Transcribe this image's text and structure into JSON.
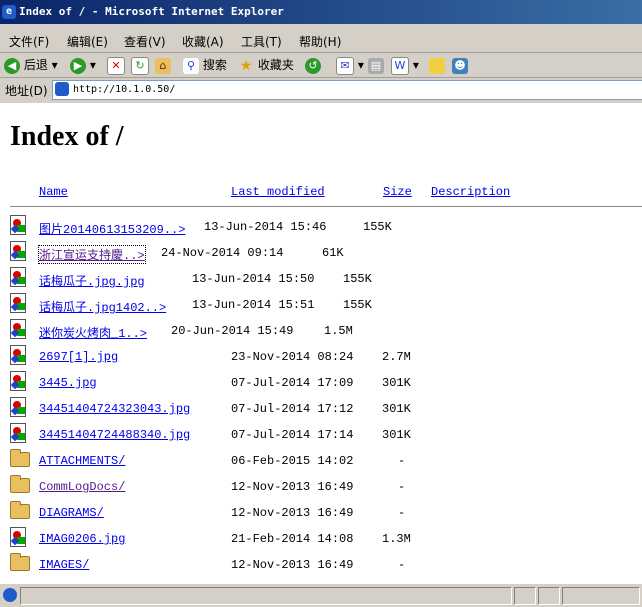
{
  "window": {
    "title": "Index of / - Microsoft Internet Explorer"
  },
  "menu": [
    {
      "label": "文件(F)"
    },
    {
      "label": "编辑(E)"
    },
    {
      "label": "查看(V)"
    },
    {
      "label": "收藏(A)"
    },
    {
      "label": "工具(T)"
    },
    {
      "label": "帮助(H)"
    }
  ],
  "toolbar": {
    "back_label": "后退",
    "search_label": "搜索",
    "favorites_label": "收藏夹"
  },
  "address": {
    "label": "地址(D)",
    "url": "http://10.1.0.50/"
  },
  "page": {
    "heading": "Index of /",
    "columns": {
      "name": "Name",
      "modified": "Last modified",
      "size": "Size",
      "description": "Description"
    }
  },
  "files": [
    {
      "type": "file",
      "name": "图片20140613153209..>",
      "date": "13-Jun-2014 15:46",
      "size": "155K"
    },
    {
      "type": "file",
      "name": "浙江宣运支持慶..>",
      "date": "24-Nov-2014 09:14",
      "size": "61K"
    },
    {
      "type": "file",
      "name": "话梅瓜子.jpg.jpg",
      "date": "13-Jun-2014 15:50",
      "size": "155K"
    },
    {
      "type": "file",
      "name": "话梅瓜子.jpg1402..>",
      "date": "13-Jun-2014 15:51",
      "size": "155K"
    },
    {
      "type": "file",
      "name": "迷你炭火烤肉_1..>",
      "date": "20-Jun-2014 15:49",
      "size": "1.5M"
    },
    {
      "type": "file",
      "name": "2697[1].jpg",
      "date": "23-Nov-2014 08:24",
      "size": "2.7M"
    },
    {
      "type": "file",
      "name": "3445.jpg",
      "date": "07-Jul-2014 17:09",
      "size": "301K"
    },
    {
      "type": "file",
      "name": "34451404724323043.jpg",
      "date": "07-Jul-2014 17:12",
      "size": "301K"
    },
    {
      "type": "file",
      "name": "34451404724488340.jpg",
      "date": "07-Jul-2014 17:14",
      "size": "301K"
    },
    {
      "type": "folder",
      "name": "ATTACHMENTS/",
      "date": "06-Feb-2015 14:02",
      "size": "-"
    },
    {
      "type": "folder",
      "name": "CommLogDocs/",
      "date": "12-Nov-2013 16:49",
      "size": "-"
    },
    {
      "type": "folder",
      "name": "DIAGRAMS/",
      "date": "12-Nov-2013 16:49",
      "size": "-"
    },
    {
      "type": "file",
      "name": "IMAG0206.jpg",
      "date": "21-Feb-2014 14:08",
      "size": "1.3M"
    },
    {
      "type": "folder",
      "name": "IMAGES/",
      "date": "12-Nov-2013 16:49",
      "size": "-"
    }
  ]
}
